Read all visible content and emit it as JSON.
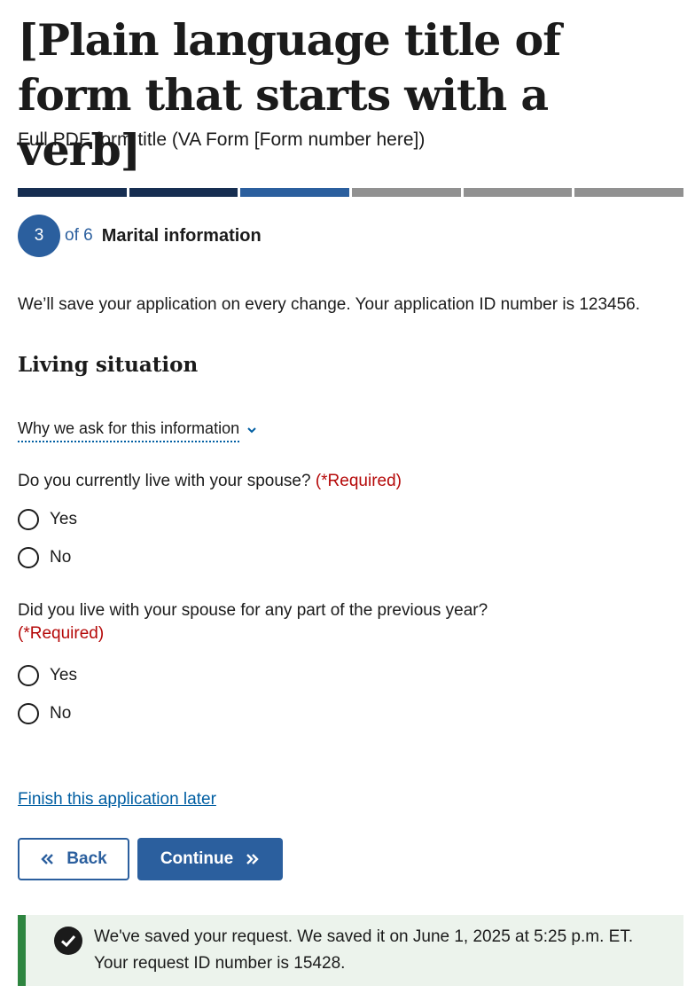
{
  "header": {
    "title": "[Plain language title of form that starts with a verb]",
    "subtitle": "Full PDF form title (VA Form [Form number here])"
  },
  "progress": {
    "current_step": 3,
    "total_steps": 6,
    "segment_colors": [
      "#162e51",
      "#162e51",
      "#2b5f9e",
      "#919191",
      "#919191",
      "#919191"
    ]
  },
  "step": {
    "number": "3",
    "of_text": "of 6",
    "name": "Marital information"
  },
  "save_note": "We’ll save your application on every change. Your application ID number is 123456.",
  "section": {
    "title": "Living situation",
    "why_label": "Why we ask for this information"
  },
  "questions": [
    {
      "label": "Do you currently live with your spouse?",
      "required": "(*Required)",
      "options": [
        "Yes",
        "No"
      ]
    },
    {
      "label": "Did you live with your spouse for any part of the previous year?",
      "required": "(*Required)",
      "options": [
        "Yes",
        "No"
      ]
    }
  ],
  "finish_later": "Finish this application later",
  "buttons": {
    "back": "Back",
    "continue": "Continue"
  },
  "alert": {
    "line1": "We've saved your request. We saved it on June 1, 2025 at 5:25 p.m. ET.",
    "line2": "Your request ID number is 15428.",
    "icon": "check-circle-icon"
  },
  "colors": {
    "primary": "#2b5f9e",
    "primary_dark": "#162e51",
    "required": "#b50909",
    "success": "#2e8540",
    "success_bg": "#ecf3ec"
  }
}
